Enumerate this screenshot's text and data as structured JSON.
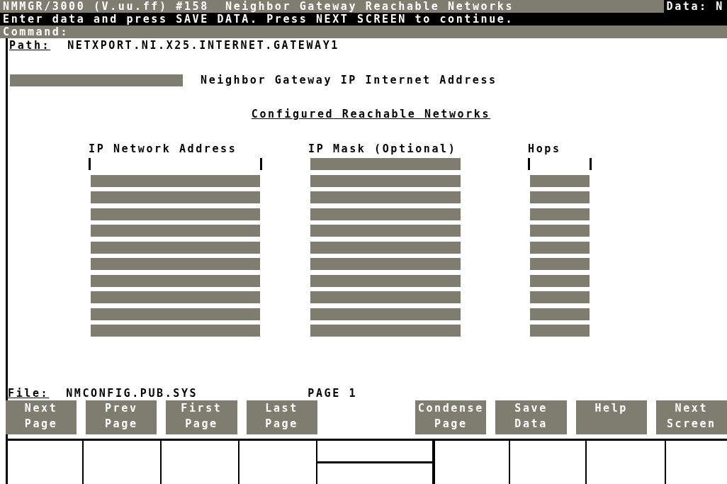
{
  "title_bar": {
    "title": "NMMGR/3000 (V.uu.ff) #158  Neighbor Gateway Reachable Networks",
    "data_flag": "Data: N"
  },
  "message": "Enter data and press SAVE DATA. Press NEXT SCREEN to continue.",
  "command": {
    "label": "Command:"
  },
  "path": {
    "label": "Path:",
    "value": "NETXPORT.NI.X25.INTERNET.GATEWAY1"
  },
  "neighbor_field": {
    "label": "Neighbor Gateway IP Internet Address",
    "shaded": true
  },
  "section_title": "Configured Reachable Networks",
  "columns": [
    "IP Network Address",
    "IP Mask (Optional)",
    "Hops"
  ],
  "rows": [
    {
      "shaded": [
        false,
        true,
        false
      ]
    },
    {
      "shaded": [
        true,
        true,
        true
      ]
    },
    {
      "shaded": [
        true,
        true,
        true
      ]
    },
    {
      "shaded": [
        true,
        true,
        true
      ]
    },
    {
      "shaded": [
        true,
        true,
        true
      ]
    },
    {
      "shaded": [
        true,
        true,
        true
      ]
    },
    {
      "shaded": [
        true,
        true,
        true
      ]
    },
    {
      "shaded": [
        true,
        true,
        true
      ]
    },
    {
      "shaded": [
        true,
        true,
        true
      ]
    },
    {
      "shaded": [
        true,
        true,
        true
      ]
    },
    {
      "shaded": [
        true,
        true,
        true
      ]
    }
  ],
  "file": {
    "label": "File:",
    "value": "NMCONFIG.PUB.SYS",
    "page": "PAGE 1"
  },
  "function_keys_left": [
    "Next\nPage",
    "Prev\nPage",
    "First\nPage",
    "Last\nPage"
  ],
  "function_keys_right": [
    "Condense\nPage",
    "Save\nData",
    "Help",
    "Next\nScreen"
  ]
}
